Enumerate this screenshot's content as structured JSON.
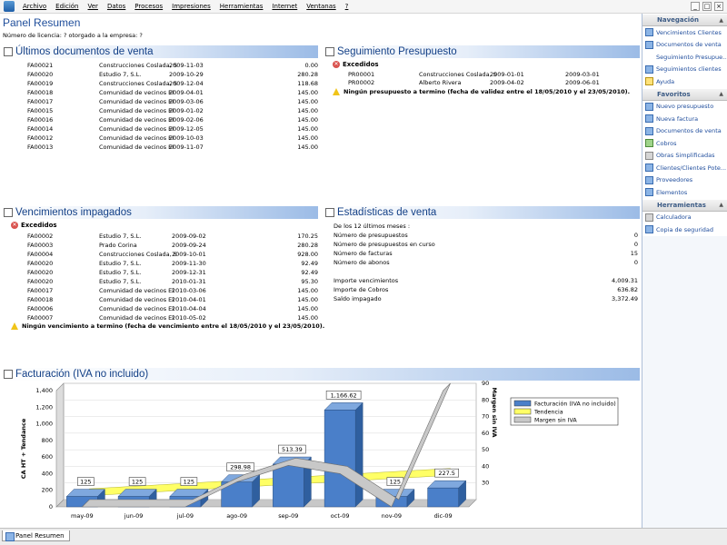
{
  "menu": [
    "Archivo",
    "Edición",
    "Ver",
    "Datos",
    "Procesos",
    "Impresiones",
    "Herramientas",
    "Internet",
    "Ventanas",
    "?"
  ],
  "page": {
    "title": "Panel Resumen",
    "license": "Número de licencia: ? otorgado a la empresa: ?"
  },
  "sales_docs": {
    "title": "Últimos documentos de venta",
    "rows": [
      {
        "doc": "FA00021",
        "client": "Construcciones Coslada, S",
        "date": "2009-11-03",
        "amount": "0.00"
      },
      {
        "doc": "FA00020",
        "client": "Estudio 7, S.L.",
        "date": "2009-10-29",
        "amount": "280.28"
      },
      {
        "doc": "FA00019",
        "client": "Construcciones Coslada, S",
        "date": "2009-12-04",
        "amount": "118.68"
      },
      {
        "doc": "FA00018",
        "client": "Comunidad de vecinos El",
        "date": "2009-04-01",
        "amount": "145.00"
      },
      {
        "doc": "FA00017",
        "client": "Comunidad de vecinos El",
        "date": "2009-03-06",
        "amount": "145.00"
      },
      {
        "doc": "FA00015",
        "client": "Comunidad de vecinos El",
        "date": "2009-01-02",
        "amount": "145.00"
      },
      {
        "doc": "FA00016",
        "client": "Comunidad de vecinos El",
        "date": "2009-02-06",
        "amount": "145.00"
      },
      {
        "doc": "FA00014",
        "client": "Comunidad de vecinos El",
        "date": "2009-12-05",
        "amount": "145.00"
      },
      {
        "doc": "FA00012",
        "client": "Comunidad de vecinos El",
        "date": "2009-10-03",
        "amount": "145.00"
      },
      {
        "doc": "FA00013",
        "client": "Comunidad de vecinos El",
        "date": "2009-11-07",
        "amount": "145.00"
      }
    ]
  },
  "budget": {
    "title": "Seguimiento Presupuesto",
    "exceeded_label": "Excedidos",
    "rows": [
      {
        "doc": "PR00001",
        "client": "Construcciones Coslada, S",
        "date1": "2009-01-01",
        "date2": "2009-03-01"
      },
      {
        "doc": "PR00002",
        "client": "Alberto Rivera",
        "date1": "2009-04-02",
        "date2": "2009-06-01"
      }
    ],
    "warning": "Ningún presupuesto a termino (fecha de validez entre el 18/05/2010 y el 23/05/2010)."
  },
  "unpaid": {
    "title": "Vencimientos impagados",
    "exceeded_label": "Excedidos",
    "rows": [
      {
        "doc": "FA00002",
        "client": "Estudio 7, S.L.",
        "date": "2009-09-02",
        "amount": "170.25"
      },
      {
        "doc": "FA00003",
        "client": "Prado Corina",
        "date": "2009-09-24",
        "amount": "280.28"
      },
      {
        "doc": "FA00004",
        "client": "Construcciones Coslada, S",
        "date": "2009-10-01",
        "amount": "928.00"
      },
      {
        "doc": "FA00020",
        "client": "Estudio 7, S.L.",
        "date": "2009-11-30",
        "amount": "92.49"
      },
      {
        "doc": "FA00020",
        "client": "Estudio 7, S.L.",
        "date": "2009-12-31",
        "amount": "92.49"
      },
      {
        "doc": "FA00020",
        "client": "Estudio 7, S.L.",
        "date": "2010-01-31",
        "amount": "95.30"
      },
      {
        "doc": "FA00017",
        "client": "Comunidad de vecinos El",
        "date": "2010-03-06",
        "amount": "145.00"
      },
      {
        "doc": "FA00018",
        "client": "Comunidad de vecinos El",
        "date": "2010-04-01",
        "amount": "145.00"
      },
      {
        "doc": "FA00006",
        "client": "Comunidad de vecinos El",
        "date": "2010-04-04",
        "amount": "145.00"
      },
      {
        "doc": "FA00007",
        "client": "Comunidad de vecinos El",
        "date": "2010-05-02",
        "amount": "145.00"
      }
    ],
    "warning": "Ningún vencimiento a termino (fecha de vencimiento entre el 18/05/2010 y el 23/05/2010)."
  },
  "stats": {
    "title": "Estadísticas de venta",
    "period": "De los 12 últimos meses :",
    "rows": [
      {
        "label": "Número de presupuestos",
        "value": "0"
      },
      {
        "label": "Número de presupuestos en curso",
        "value": "0"
      },
      {
        "label": "Número de facturas",
        "value": "15"
      },
      {
        "label": "Número de abonos",
        "value": "0"
      }
    ],
    "rows2": [
      {
        "label": "Importe vencimientos",
        "value": "4,009.31"
      },
      {
        "label": "Importe de Cobros",
        "value": "636.82"
      },
      {
        "label": "Saldo impagado",
        "value": "3,372.49"
      }
    ]
  },
  "billing": {
    "title": "Facturación (IVA no incluido)"
  },
  "chart_data": {
    "type": "bar",
    "title": "",
    "categories": [
      "may-09",
      "jun-09",
      "jul-09",
      "ago-09",
      "sep-09",
      "oct-09",
      "nov-09",
      "dic-09"
    ],
    "series": [
      {
        "name": "Facturación (IVA no incluido)",
        "type": "bar",
        "axis": "left",
        "values": [
          125,
          125,
          125,
          298.98,
          513.39,
          1166.62,
          125,
          227.5
        ],
        "labels": [
          "125",
          "125",
          "125",
          "298.98",
          "513.39",
          "1,166.62",
          "125",
          "227.5"
        ],
        "color": "#4a7fc9"
      },
      {
        "name": "Tendencia",
        "type": "line",
        "axis": "left",
        "values": [
          130,
          165,
          200,
          235,
          270,
          305,
          340,
          375
        ],
        "color": "#ffff66"
      },
      {
        "name": "Margen sin IVA",
        "type": "line",
        "axis": "right",
        "values": [
          20,
          20,
          20,
          35,
          45,
          40,
          20,
          90
        ],
        "color": "#c8c8c8"
      }
    ],
    "ylabel": "CA HT + Tendance",
    "y2label": "Margen sin IVA",
    "ylim": [
      0,
      1400
    ],
    "y2lim": [
      20,
      90
    ],
    "yticks": [
      "0",
      "200",
      "400",
      "600",
      "800",
      "1,000",
      "1,200",
      "1,400"
    ],
    "y2ticks": [
      "30",
      "40",
      "50",
      "60",
      "70",
      "80",
      "90"
    ],
    "legend_position": "top-right",
    "grid": true
  },
  "sidebar": {
    "navegacion": {
      "title": "Navegación",
      "items": [
        "Vencimientos Clientes",
        "Documentos de venta",
        "Seguimiento Presupue...",
        "Seguimientos clientes",
        "Ayuda"
      ]
    },
    "favoritos": {
      "title": "Favoritos",
      "items": [
        "Nuevo presupuesto",
        "Nueva factura",
        "Documentos de venta",
        "Cobros",
        "Obras Simplificadas",
        "Clientes/Clientes Pote...",
        "Proveedores",
        "Elementos"
      ]
    },
    "herramientas": {
      "title": "Herramientas",
      "items": [
        "Calculadora",
        "Copia de seguridad"
      ]
    }
  },
  "status": {
    "tab": "Panel Resumen"
  }
}
